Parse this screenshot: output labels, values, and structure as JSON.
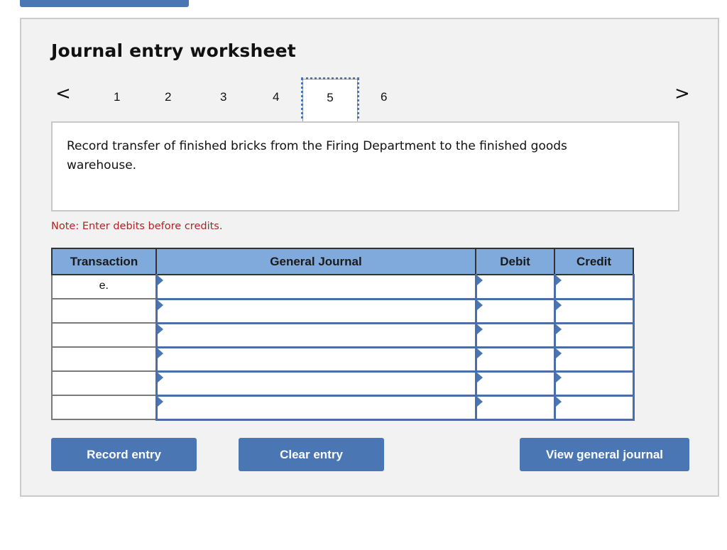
{
  "header": {
    "title": "Journal entry worksheet"
  },
  "navigation": {
    "prev_icon": "chevron-left-icon",
    "next_icon": "chevron-right-icon",
    "prev_glyph": "<",
    "next_glyph": ">",
    "steps": [
      "1",
      "2",
      "3",
      "4",
      "5",
      "6"
    ],
    "active_step": "5"
  },
  "description": {
    "text": "Record transfer of finished bricks from the Firing Department to the finished goods warehouse."
  },
  "note": "Note: Enter debits before credits.",
  "table": {
    "columns": [
      "Transaction",
      "General Journal",
      "Debit",
      "Credit"
    ],
    "rows": [
      {
        "transaction": "e.",
        "account": "",
        "debit": "",
        "credit": ""
      },
      {
        "transaction": "",
        "account": "",
        "debit": "",
        "credit": ""
      },
      {
        "transaction": "",
        "account": "",
        "debit": "",
        "credit": ""
      },
      {
        "transaction": "",
        "account": "",
        "debit": "",
        "credit": ""
      },
      {
        "transaction": "",
        "account": "",
        "debit": "",
        "credit": ""
      },
      {
        "transaction": "",
        "account": "",
        "debit": "",
        "credit": ""
      }
    ]
  },
  "buttons": {
    "record": "Record entry",
    "clear": "Clear entry",
    "view": "View general journal"
  },
  "colors": {
    "accent": "#4a76b4",
    "header_fill": "#80aadc",
    "note": "#b02424",
    "panel_bg": "#f2f2f2"
  }
}
